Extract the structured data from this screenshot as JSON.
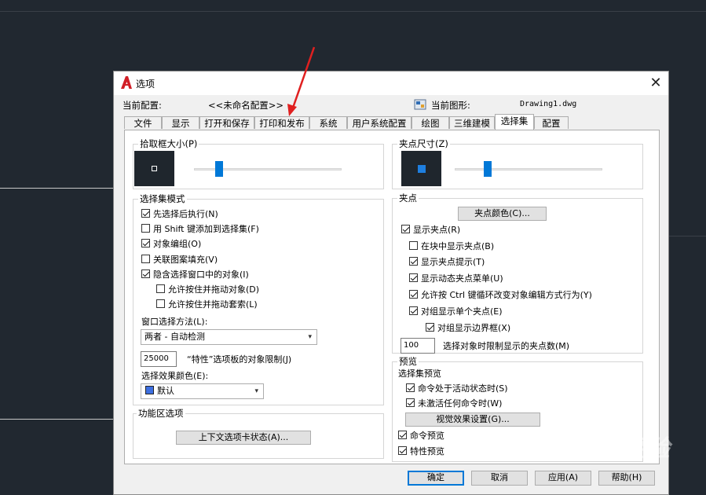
{
  "colors": {
    "background": "#212830",
    "accent": "#0078d7",
    "annotation_arrow": "#e02020"
  },
  "dialog": {
    "title": "选项",
    "icon": "autocad-a-icon",
    "profile_label": "当前配置:",
    "profile_value": "<<未命名配置>>",
    "drawing_label": "当前图形:",
    "drawing_value": "Drawing1.dwg",
    "tabs": [
      "文件",
      "显示",
      "打开和保存",
      "打印和发布",
      "系统",
      "用户系统配置",
      "绘图",
      "三维建模",
      "选择集",
      "配置"
    ],
    "active_tab": "选择集"
  },
  "pickbox": {
    "title": "拾取框大小(P)",
    "level": 0.22
  },
  "selection_modes": {
    "title": "选择集模式",
    "items": [
      {
        "label": "先选择后执行(N)",
        "checked": true
      },
      {
        "label": "用 Shift 键添加到选择集(F)",
        "checked": false
      },
      {
        "label": "对象编组(O)",
        "checked": true
      },
      {
        "label": "关联图案填充(V)",
        "checked": false
      },
      {
        "label": "隐含选择窗口中的对象(I)",
        "checked": true
      },
      {
        "label": "允许按住并拖动对象(D)",
        "checked": false
      },
      {
        "label": "允许按住并拖动套索(L)",
        "checked": false
      }
    ],
    "window_method_label": "窗口选择方法(L):",
    "window_method_value": "两者 - 自动检测",
    "limit_value": "25000",
    "limit_label": "“特性”选项板的对象限制(J)",
    "effect_color_label": "选择效果颜色(E):",
    "effect_color_value": "默认",
    "effect_swatch": "#3d6fe0"
  },
  "ribbon": {
    "title": "功能区选项",
    "button": "上下文选项卡状态(A)..."
  },
  "gripsize": {
    "title": "夹点尺寸(Z)",
    "level": 0.22
  },
  "grips": {
    "title": "夹点",
    "color_button": "夹点颜色(C)...",
    "items": [
      {
        "label": "显示夹点(R)",
        "checked": true
      },
      {
        "label": "在块中显示夹点(B)",
        "checked": false
      },
      {
        "label": "显示夹点提示(T)",
        "checked": true
      },
      {
        "label": "显示动态夹点菜单(U)",
        "checked": true
      },
      {
        "label": "允许按 Ctrl 键循环改变对象编辑方式行为(Y)",
        "checked": true
      },
      {
        "label": "对组显示单个夹点(E)",
        "checked": true
      },
      {
        "label": "对组显示边界框(X)",
        "checked": true
      }
    ],
    "limit_value": "100",
    "limit_label": "选择对象时限制显示的夹点数(M)"
  },
  "preview": {
    "title": "预览",
    "subtitle": "选择集预览",
    "items": [
      {
        "label": "命令处于活动状态时(S)",
        "checked": true
      },
      {
        "label": "未激活任何命令时(W)",
        "checked": true
      }
    ],
    "visual_button": "视觉效果设置(G)...",
    "extra": [
      {
        "label": "命令预览",
        "checked": true
      },
      {
        "label": "特性预览",
        "checked": true
      }
    ]
  },
  "footer": {
    "ok": "确定",
    "cancel": "取消",
    "apply": "应用(A)",
    "help": "帮助(H)"
  },
  "watermark": "Baidu 经验"
}
